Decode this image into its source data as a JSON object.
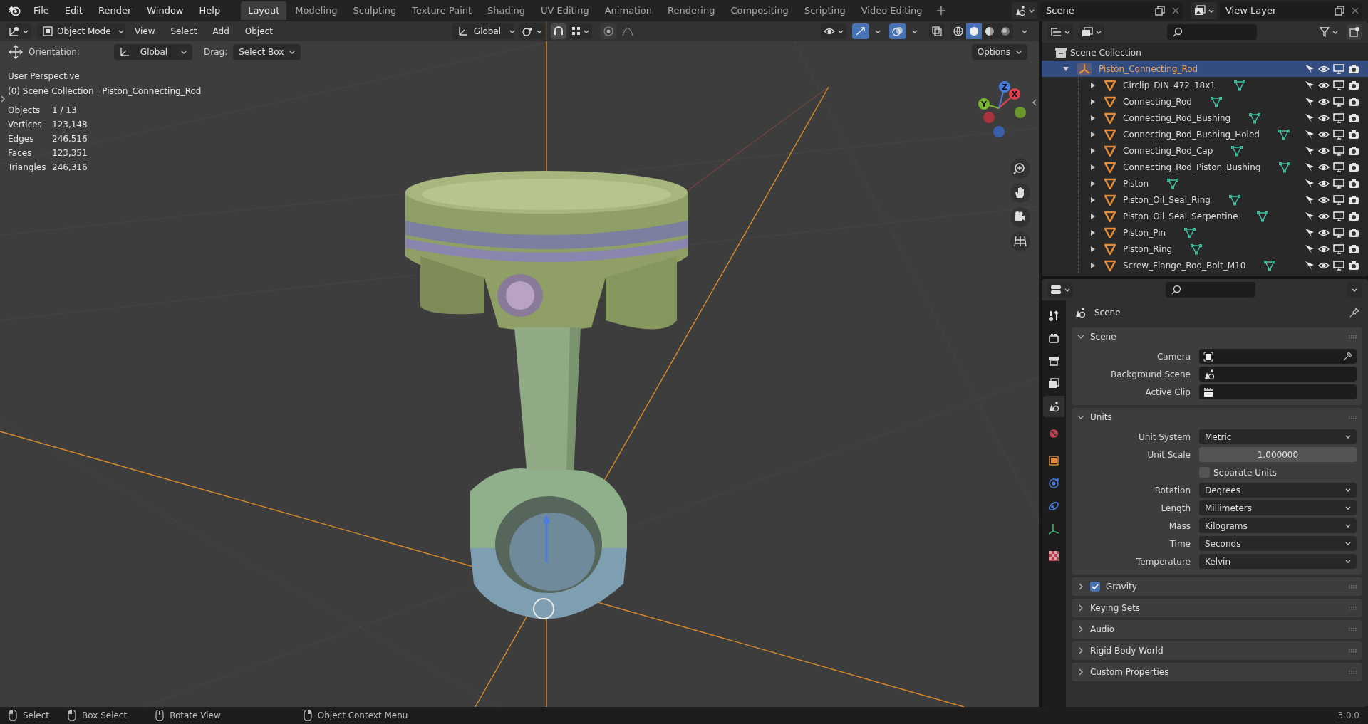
{
  "menu": [
    "File",
    "Edit",
    "Render",
    "Window",
    "Help"
  ],
  "workspaces": [
    {
      "label": "Layout",
      "selected": true
    },
    {
      "label": "Modeling",
      "selected": false
    },
    {
      "label": "Sculpting",
      "selected": false
    },
    {
      "label": "Texture Paint",
      "selected": false
    },
    {
      "label": "Shading",
      "selected": false
    },
    {
      "label": "UV Editing",
      "selected": false
    },
    {
      "label": "Animation",
      "selected": false
    },
    {
      "label": "Rendering",
      "selected": false
    },
    {
      "label": "Compositing",
      "selected": false
    },
    {
      "label": "Scripting",
      "selected": false
    },
    {
      "label": "Video Editing",
      "selected": false
    }
  ],
  "scene_field": "Scene",
  "view_layer_field": "View Layer",
  "viewport": {
    "mode": "Object Mode",
    "menus": [
      "View",
      "Select",
      "Add",
      "Object"
    ],
    "transform": "Global",
    "shading_modes": [
      {
        "selected": false
      },
      {
        "selected": true
      },
      {
        "selected": false
      },
      {
        "selected": false
      }
    ],
    "tool_settings": {
      "orientation_label": "Orientation:",
      "orientation": "Global",
      "drag_label": "Drag:",
      "drag": "Select Box",
      "options": "Options"
    },
    "perspective": "User Perspective",
    "collection": "(0) Scene Collection | Piston_Connecting_Rod",
    "stats": [
      {
        "label": "Objects",
        "value": "1 / 13"
      },
      {
        "label": "Vertices",
        "value": "123,148"
      },
      {
        "label": "Edges",
        "value": "246,516"
      },
      {
        "label": "Faces",
        "value": "123,351"
      },
      {
        "label": "Triangles",
        "value": "246,316"
      }
    ],
    "gizmo_axes": [
      "X",
      "Y",
      "Z"
    ]
  },
  "outliner": {
    "root": "Scene Collection",
    "items": [
      {
        "name": "Piston_Connecting_Rod",
        "kind": "empty",
        "selected": true,
        "expanded": true,
        "children": [
          {
            "name": "Circlip_DIN_472_18x1",
            "kind": "mesh",
            "selected": false,
            "expanded": false
          },
          {
            "name": "Connecting_Rod",
            "kind": "mesh",
            "selected": false,
            "expanded": false
          },
          {
            "name": "Connecting_Rod_Bushing",
            "kind": "mesh",
            "selected": false,
            "expanded": false
          },
          {
            "name": "Connecting_Rod_Bushing_Holed",
            "kind": "mesh",
            "selected": false,
            "expanded": false
          },
          {
            "name": "Connecting_Rod_Cap",
            "kind": "mesh",
            "selected": false,
            "expanded": false
          },
          {
            "name": "Connecting_Rod_Piston_Bushing",
            "kind": "mesh",
            "selected": false,
            "expanded": false
          },
          {
            "name": "Piston",
            "kind": "mesh",
            "selected": false,
            "expanded": false
          },
          {
            "name": "Piston_Oil_Seal_Ring",
            "kind": "mesh",
            "selected": false,
            "expanded": false
          },
          {
            "name": "Piston_Oil_Seal_Serpentine",
            "kind": "mesh",
            "selected": false,
            "expanded": false
          },
          {
            "name": "Piston_Pin",
            "kind": "mesh",
            "selected": false,
            "expanded": false
          },
          {
            "name": "Piston_Ring",
            "kind": "mesh",
            "selected": false,
            "expanded": false
          },
          {
            "name": "Screw_Flange_Rod_Bolt_M10",
            "kind": "mesh",
            "selected": false,
            "expanded": false
          }
        ]
      }
    ]
  },
  "properties": {
    "title": "Scene",
    "tabs": [
      {
        "kind": "tool",
        "selected": false
      },
      {
        "kind": "render",
        "selected": false
      },
      {
        "kind": "output",
        "selected": false
      },
      {
        "kind": "view_layer",
        "selected": false
      },
      {
        "kind": "scene",
        "selected": true
      },
      {
        "kind": "world",
        "selected": false
      },
      {
        "kind": "object",
        "selected": false
      },
      {
        "kind": "physics",
        "selected": false
      },
      {
        "kind": "constraints",
        "selected": false
      },
      {
        "kind": "data",
        "selected": false
      },
      {
        "kind": "texture",
        "selected": false
      }
    ],
    "panels": [
      {
        "title": "Scene",
        "kind": "plain",
        "expanded": true,
        "rows": [
          {
            "label": "Camera",
            "kind": "camera"
          },
          {
            "label": "Background Scene",
            "kind": "scene"
          },
          {
            "label": "Active Clip",
            "kind": "clip"
          }
        ]
      },
      {
        "title": "Units",
        "kind": "plain",
        "expanded": true,
        "rows": [
          {
            "label": "Unit System",
            "kind": "dropdown",
            "value": "Metric"
          },
          {
            "label": "Unit Scale",
            "kind": "number",
            "value": "1.000000"
          },
          {
            "label": "Separate Units",
            "kind": "checkbox",
            "checked": false
          },
          {
            "label": "Rotation",
            "kind": "dropdown",
            "value": "Degrees"
          },
          {
            "label": "Length",
            "kind": "dropdown",
            "value": "Millimeters"
          },
          {
            "label": "Mass",
            "kind": "dropdown",
            "value": "Kilograms"
          },
          {
            "label": "Time",
            "kind": "dropdown",
            "value": "Seconds"
          },
          {
            "label": "Temperature",
            "kind": "dropdown",
            "value": "Kelvin"
          }
        ]
      },
      {
        "title": "Gravity",
        "kind": "toggle",
        "checked": true,
        "expanded": false
      },
      {
        "title": "Keying Sets",
        "kind": "plain",
        "expanded": false
      },
      {
        "title": "Audio",
        "kind": "plain",
        "expanded": false
      },
      {
        "title": "Rigid Body World",
        "kind": "plain",
        "expanded": false
      },
      {
        "title": "Custom Properties",
        "kind": "plain",
        "expanded": false
      }
    ]
  },
  "status_bar": {
    "hints": [
      {
        "kind": "left",
        "label": "Select"
      },
      {
        "kind": "left",
        "label": "Box Select"
      },
      {
        "kind": "middle",
        "label": "Rotate View"
      },
      {
        "kind": "right",
        "label": "Object Context Menu"
      }
    ],
    "version": "3.0.0"
  }
}
